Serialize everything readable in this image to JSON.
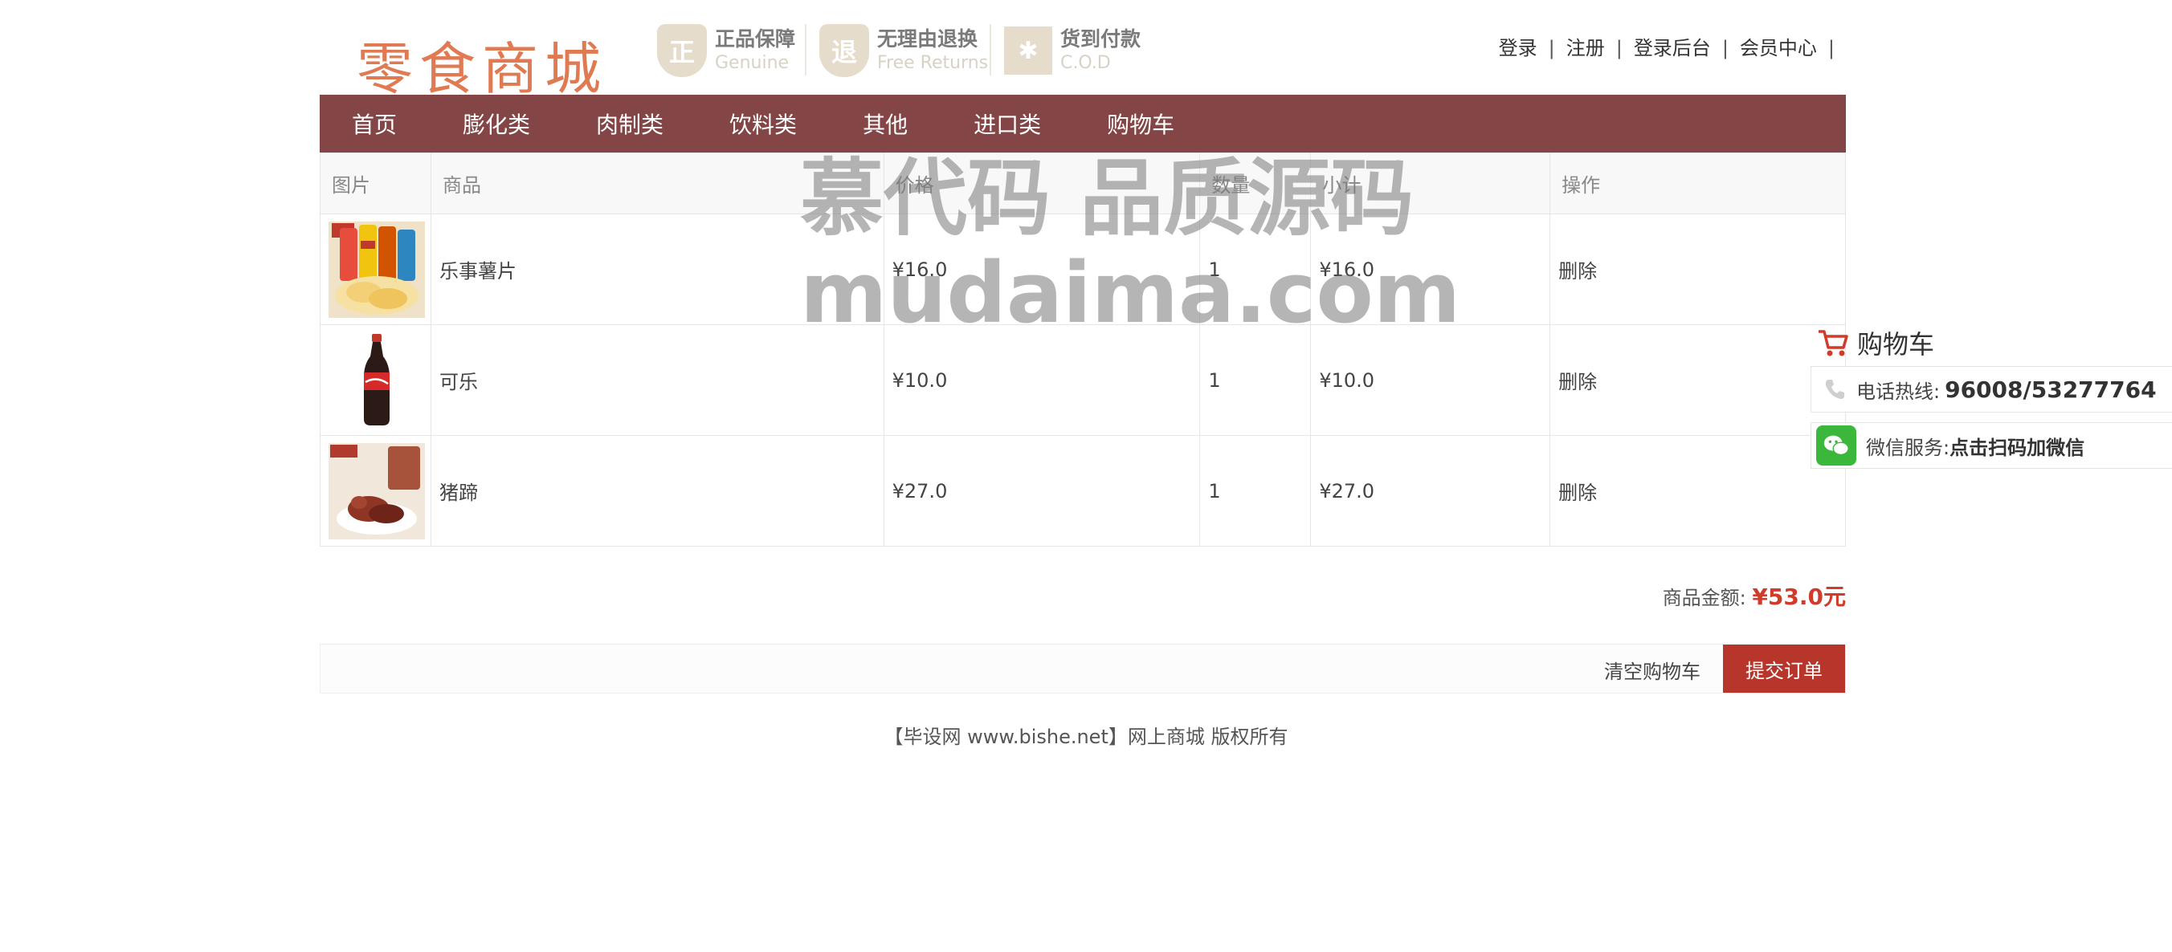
{
  "header": {
    "logo_text": "零食商城",
    "badges": [
      {
        "icon": "shield-zheng-icon",
        "glyph": "正",
        "title": "正品保障",
        "subtitle": "Genuine"
      },
      {
        "icon": "shield-tui-icon",
        "glyph": "退",
        "title": "无理由退换",
        "subtitle": "Free Returns"
      },
      {
        "icon": "gift-icon",
        "glyph": "✱",
        "title": "货到付款",
        "subtitle": "C.O.D"
      }
    ],
    "links": {
      "login": "登录",
      "register": "注册",
      "admin": "登录后台",
      "member": "会员中心",
      "sep": "|"
    }
  },
  "nav": [
    "首页",
    "膨化类",
    "肉制类",
    "饮料类",
    "其他",
    "进口类",
    "购物车"
  ],
  "cart": {
    "headers": [
      "图片",
      "商品",
      "价格",
      "数量",
      "小计",
      "操作"
    ],
    "rows": [
      {
        "image": "lays-chips-image",
        "name": "乐事薯片",
        "price": "¥16.0",
        "qty": "1",
        "subtotal": "¥16.0",
        "action": "删除"
      },
      {
        "image": "cola-bottle-image",
        "name": "可乐",
        "price": "¥10.0",
        "qty": "1",
        "subtotal": "¥10.0",
        "action": "删除"
      },
      {
        "image": "pig-trotter-image",
        "name": "猪蹄",
        "price": "¥27.0",
        "qty": "1",
        "subtotal": "¥27.0",
        "action": "删除"
      }
    ],
    "total_label": "商品金额:",
    "total_value": "¥53.0元",
    "clear_label": "清空购物车",
    "submit_label": "提交订单"
  },
  "footer": "【毕设网 www.bishe.net】网上商城 版权所有",
  "float_panel": {
    "cart_label": "购物车",
    "hotline_label": "电话热线:",
    "hotline_value": "96008/53277764",
    "wechat_label": "微信服务:",
    "wechat_value": "点击扫码加微信"
  },
  "watermark": {
    "line1": "慕代码 品质源码",
    "line2": "mudaima.com"
  },
  "colors": {
    "nav_bg": "#834545",
    "accent_red": "#d13b2c",
    "submit_bg": "#b7352a",
    "logo": "#e07a52"
  }
}
